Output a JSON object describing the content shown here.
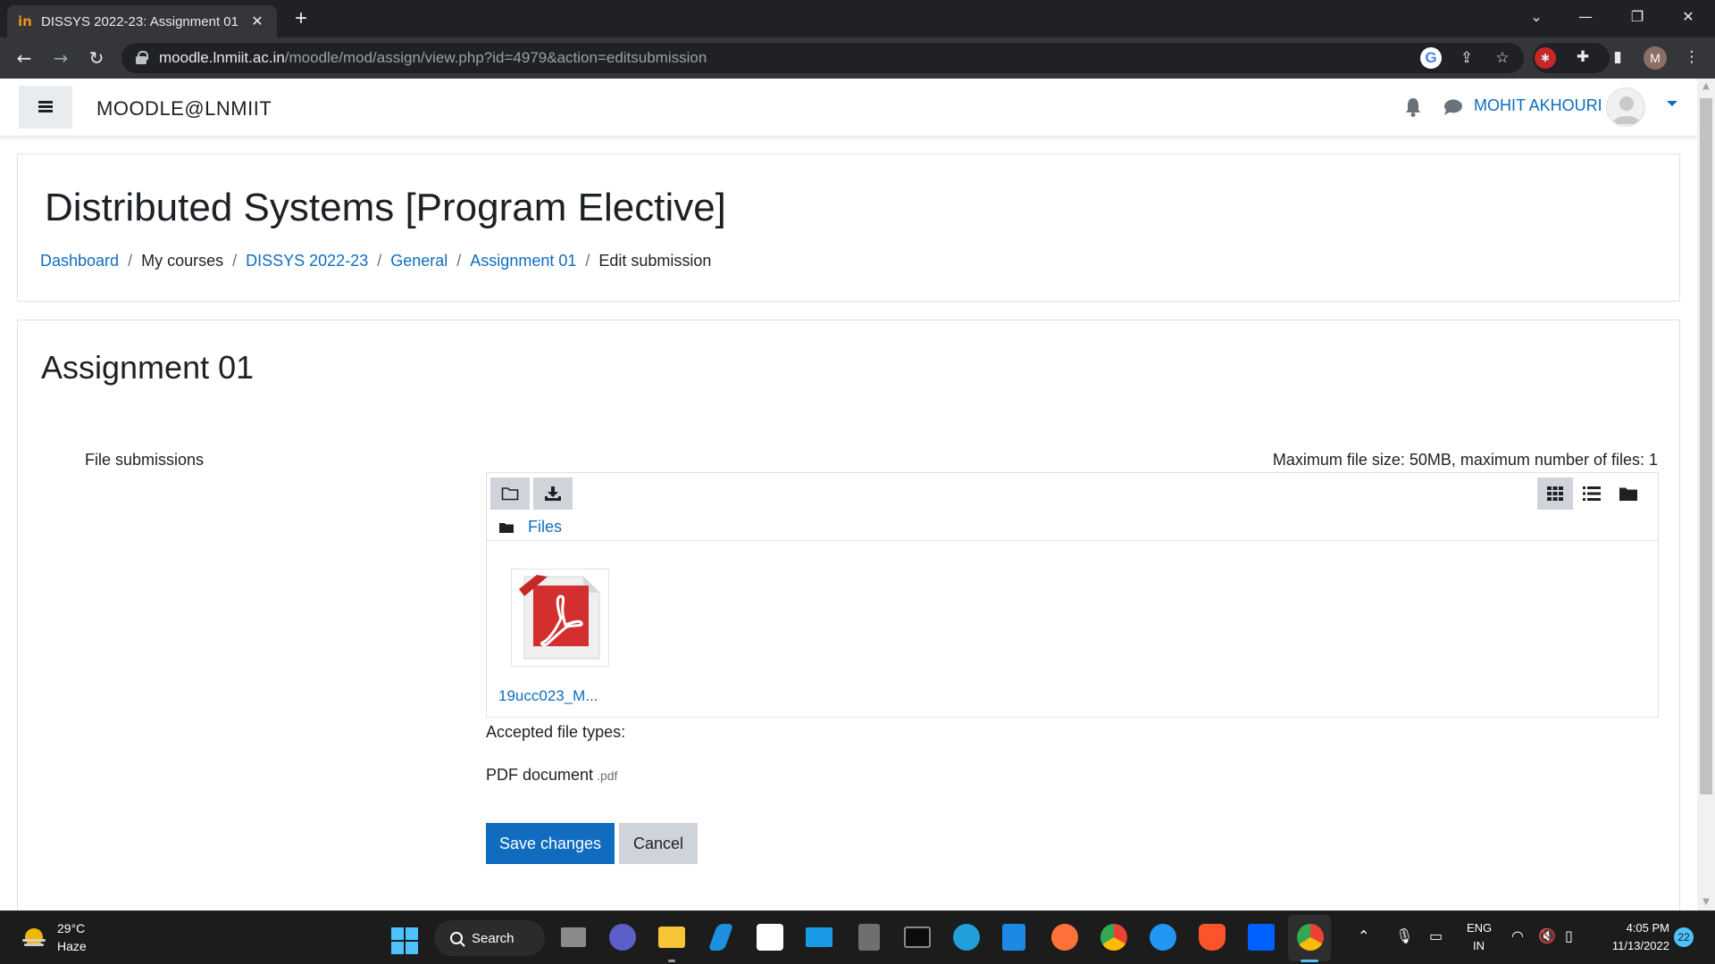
{
  "browser": {
    "tab_title": "DISSYS 2022-23: Assignment 01",
    "favicon_text": "in",
    "url_host": "moodle.lnmiit.ac.in",
    "url_path": "/moodle/mod/assign/view.php?id=4979&action=editsubmission",
    "profile_initial": "M"
  },
  "navbar": {
    "site_name": "MOODLE@LNMIIT",
    "user_name": "MOHIT AKHOURI"
  },
  "header": {
    "title": "Distributed Systems [Program Elective]",
    "breadcrumb": [
      {
        "label": "Dashboard",
        "link": true
      },
      {
        "label": "My courses",
        "link": false
      },
      {
        "label": "DISSYS 2022-23",
        "link": true
      },
      {
        "label": "General",
        "link": true
      },
      {
        "label": "Assignment 01",
        "link": true
      },
      {
        "label": "Edit submission",
        "link": false
      }
    ]
  },
  "main": {
    "assignment_title": "Assignment 01",
    "field_label": "File submissions",
    "limits_text": "Maximum file size: 50MB, maximum number of files: 1",
    "filemanager": {
      "path_label": "Files",
      "files": [
        {
          "name": "19ucc023_M...",
          "icon": "pdf-file-icon"
        }
      ]
    },
    "accepted_label": "Accepted file types:",
    "accepted_type": "PDF document",
    "accepted_ext": ".pdf",
    "save_label": "Save changes",
    "cancel_label": "Cancel"
  },
  "taskbar": {
    "weather_temp": "29°C",
    "weather_desc": "Haze",
    "search_label": "Search",
    "lang_line1": "ENG",
    "lang_line2": "IN",
    "time": "4:05 PM",
    "date": "11/13/2022",
    "notification_count": "22"
  },
  "colors": {
    "accent": "#0f6cbf",
    "chrome_dark": "#202124",
    "taskbar": "#1c1c1c"
  }
}
